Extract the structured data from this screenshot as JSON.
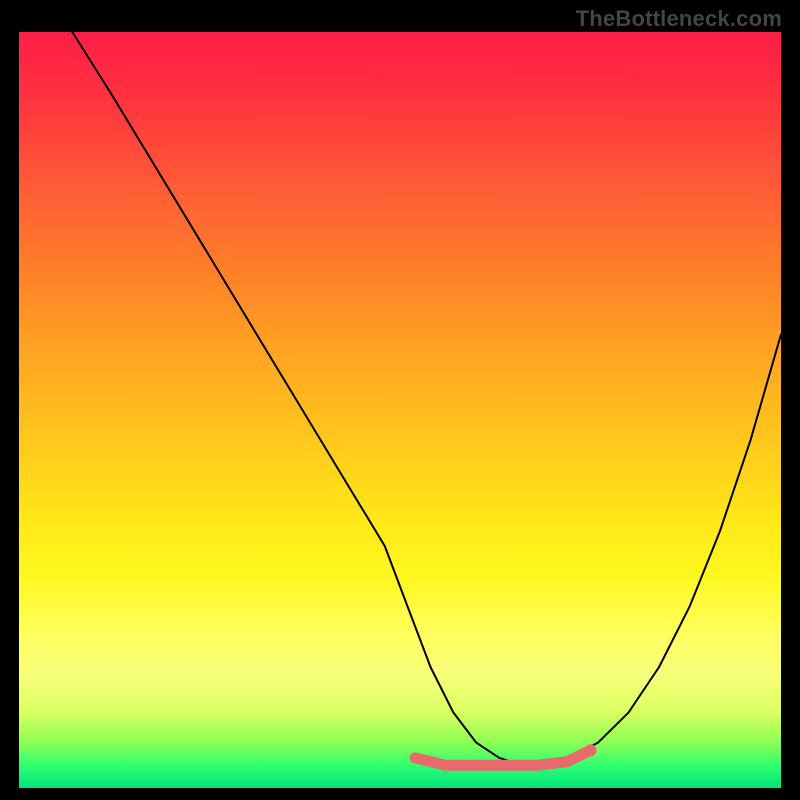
{
  "attribution": "TheBottleneck.com",
  "chart_data": {
    "type": "line",
    "title": "",
    "xlabel": "",
    "ylabel": "",
    "xlim": [
      0,
      100
    ],
    "ylim": [
      0,
      100
    ],
    "grid": false,
    "legend": false,
    "background": "heatmap-gradient",
    "series": [
      {
        "name": "curve",
        "color": "#000000",
        "x": [
          7,
          12,
          18,
          24,
          30,
          36,
          42,
          48,
          51,
          54,
          57,
          60,
          63,
          66,
          69,
          72,
          76,
          80,
          84,
          88,
          92,
          96,
          100
        ],
        "values": [
          100,
          92,
          82,
          72,
          62,
          52,
          42,
          32,
          24,
          16,
          10,
          6,
          4,
          3,
          3,
          4,
          6,
          10,
          16,
          24,
          34,
          46,
          60
        ]
      },
      {
        "name": "flat-marker-band",
        "color": "#e86a6a",
        "x": [
          52,
          56,
          60,
          64,
          68,
          72,
          75
        ],
        "values": [
          4,
          3,
          3,
          3,
          3,
          3.5,
          5
        ]
      }
    ]
  }
}
